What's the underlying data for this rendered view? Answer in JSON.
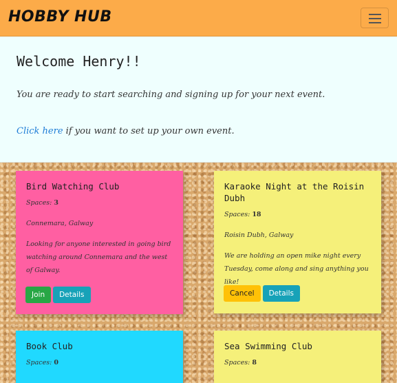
{
  "navbar": {
    "brand": "HOBBY HUB",
    "bg_color": "#fcab49"
  },
  "welcome": {
    "heading": "Welcome Henry!!",
    "line1": "You are ready to start searching and signing up for your next event.",
    "link_text": "Click here",
    "line2_rest": " if you want to set up your own event."
  },
  "cards": [
    {
      "title": "Bird Watching Club",
      "spaces_label": "Spaces:",
      "spaces": "3",
      "location": "Connemara, Galway",
      "description": "Looking for anyone interested in going bird watching around Connemara and the west of Galway.",
      "buttons": [
        "Join",
        "Details"
      ],
      "color": "#ff5fa2"
    },
    {
      "title": "Karaoke Night at the Roisin Dubh",
      "spaces_label": "Spaces:",
      "spaces": "18",
      "location": "Roisin Dubh, Galway",
      "description": "We are holding an open mike night every Tuesday, come along and sing anything you like!",
      "buttons": [
        "Cancel",
        "Details"
      ],
      "color": "#f5f07a"
    },
    {
      "title": "Book Club",
      "spaces_label": "Spaces:",
      "spaces": "0",
      "color": "#20d9ff"
    },
    {
      "title": "Sea Swimming Club",
      "spaces_label": "Spaces:",
      "spaces": "8",
      "color": "#f5f07a"
    }
  ]
}
